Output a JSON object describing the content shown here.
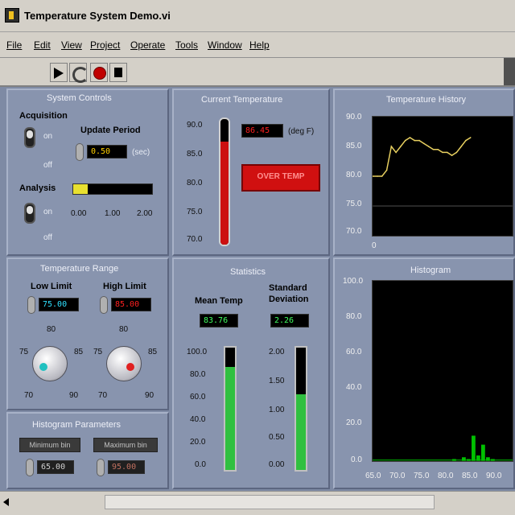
{
  "window": {
    "title": "Temperature System Demo.vi"
  },
  "menu": [
    "File",
    "Edit",
    "View",
    "Project",
    "Operate",
    "Tools",
    "Window",
    "Help"
  ],
  "system_controls": {
    "title": "System Controls",
    "acquisition_label": "Acquisition",
    "acquisition_on": "on",
    "acquisition_off": "off",
    "update_period_label": "Update Period",
    "update_period_value": "0.50",
    "update_period_unit": "(sec)",
    "analysis_label": "Analysis",
    "analysis_on": "on",
    "analysis_off": "off",
    "analysis_ticks": [
      "0.00",
      "1.00",
      "2.00"
    ],
    "analysis_level": 0.18
  },
  "current_temperature": {
    "title": "Current Temperature",
    "value": "86.45",
    "unit": "(deg F)",
    "alarm_text": "OVER TEMP",
    "scale": [
      "90.0",
      "85.0",
      "80.0",
      "75.0",
      "70.0"
    ],
    "fill_level": 0.82
  },
  "temperature_history": {
    "title": "Temperature History",
    "y_ticks": [
      "90.0",
      "85.0",
      "80.0",
      "75.0",
      "70.0"
    ],
    "x_tick": "0"
  },
  "temperature_range": {
    "title": "Temperature Range",
    "low_label": "Low Limit",
    "low_value": "75.00",
    "high_label": "High Limit",
    "high_value": "85.00",
    "knob_top": "80",
    "knob_left": "75",
    "knob_right": "85",
    "knob_min": "70",
    "knob_max": "90"
  },
  "statistics": {
    "title": "Statistics",
    "mean_label": "Mean Temp",
    "mean_value": "83.76",
    "std_label_line1": "Standard",
    "std_label_line2": "Deviation",
    "std_value": "2.26",
    "mean_scale": [
      "100.0",
      "80.0",
      "60.0",
      "40.0",
      "20.0",
      "0.0"
    ],
    "std_scale": [
      "2.00",
      "1.50",
      "1.00",
      "0.50",
      "0.00"
    ],
    "mean_level": 0.84,
    "std_level": 0.62
  },
  "histogram": {
    "title": "Histogram",
    "y_ticks": [
      "100.0",
      "80.0",
      "60.0",
      "40.0",
      "20.0",
      "0.0"
    ],
    "x_ticks": [
      "65.0",
      "70.0",
      "75.0",
      "80.0",
      "85.0",
      "90.0"
    ]
  },
  "histogram_parameters": {
    "title": "Histogram Parameters",
    "btn1": "Minimum bin",
    "btn2": "Maximum bin",
    "val1": "65.00",
    "val2": "95.00"
  },
  "chart_data": {
    "type": "line",
    "title": "Temperature History",
    "ylim": [
      70,
      90
    ],
    "x": [
      0,
      2,
      4,
      6,
      8,
      10,
      12,
      14,
      16,
      18,
      20,
      22,
      24,
      26,
      28,
      30,
      32,
      34,
      36,
      38,
      40,
      42
    ],
    "values": [
      80,
      80,
      80,
      81,
      85,
      84,
      85,
      86,
      86.5,
      86,
      86,
      85.5,
      85,
      84.5,
      84.5,
      84,
      84,
      83.5,
      84,
      85,
      86,
      86.5
    ],
    "histogram_bins": [
      76,
      77,
      78,
      79,
      80,
      81,
      82,
      83,
      84,
      85,
      86,
      87,
      88,
      89
    ],
    "histogram_counts": [
      0,
      0,
      0,
      0,
      1,
      0,
      2,
      1,
      14,
      3,
      9,
      2,
      1,
      0
    ],
    "histogram_xlim": [
      63,
      92
    ],
    "histogram_ylim": [
      0,
      100
    ],
    "reference_line": 75
  },
  "colors": {
    "panel": "#8894ae",
    "plot": "#000000",
    "trace": "#e8d060",
    "histogram": "#00c000",
    "alarm": "#d01010"
  }
}
